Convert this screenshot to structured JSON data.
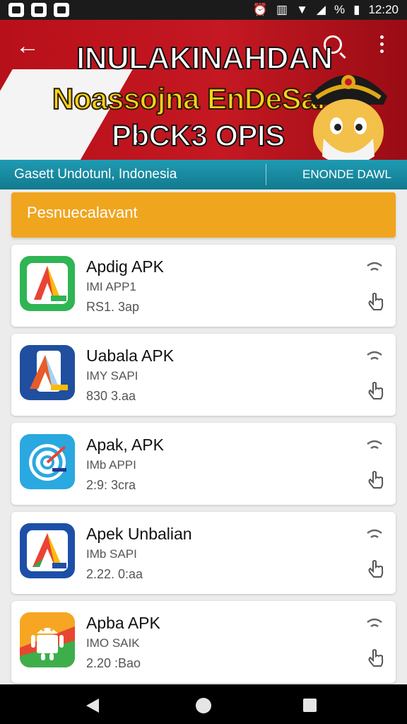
{
  "status_bar": {
    "time": "12:20",
    "battery": "%"
  },
  "banner": {
    "line1": "INULAKINAHDAN",
    "line2": "Noassojna EnDeSai",
    "line3": "PbCK3 OPIS"
  },
  "subbar": {
    "left": "Gasett Undotunl, Indonesia",
    "right": "ENONDE DAWL"
  },
  "section_header": "Pesnuecalavant",
  "apps": [
    {
      "name": "Apdig APK",
      "meta1": "IMI APP1",
      "meta2": "RS1. 3ap",
      "icon": "green-arrow-app-icon"
    },
    {
      "name": "Uabala APK",
      "meta1": "IMY SAPI",
      "meta2": "830 3.aa",
      "icon": "phone-arrow-app-icon"
    },
    {
      "name": "Apak, APK",
      "meta1": "IMb APPI",
      "meta2": "2:9: 3cra",
      "icon": "target-app-icon"
    },
    {
      "name": "Apek Unbalian",
      "meta1": "IMb SAPI",
      "meta2": "2.22. 0:aa",
      "icon": "blue-arrow-app-icon"
    },
    {
      "name": "Apba APK",
      "meta1": "IMO SAIK",
      "meta2": "2.20 :Bao",
      "icon": "android-app-icon"
    }
  ],
  "colors": {
    "banner_red": "#c41822",
    "subbar_teal": "#1a8ca3",
    "section_orange": "#f0a51e"
  }
}
